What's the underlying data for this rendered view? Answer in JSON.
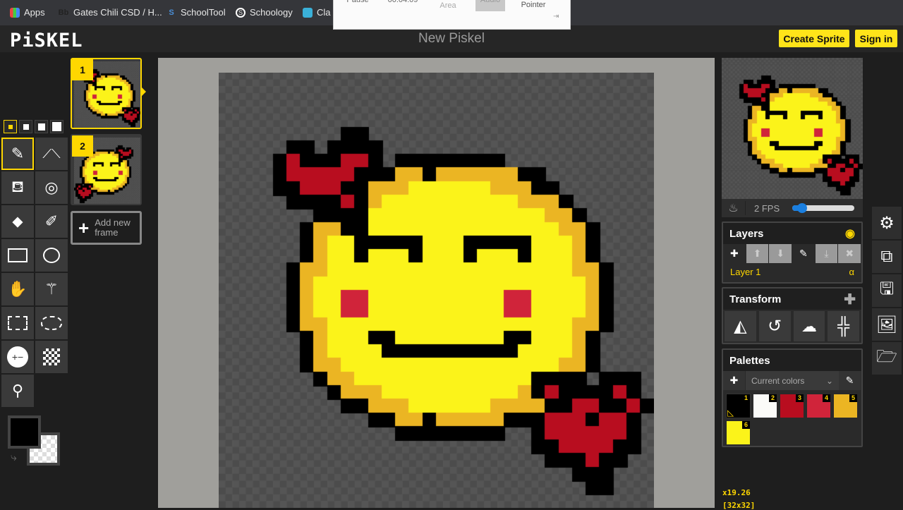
{
  "bookmarks": [
    {
      "icon": "apps-grid-icon",
      "label": "Apps"
    },
    {
      "icon": "blackboard-icon",
      "label": "Gates Chili CSD / H..."
    },
    {
      "icon": "schooltool-icon",
      "label": "SchoolTool"
    },
    {
      "icon": "schoology-icon",
      "label": "Schoology"
    },
    {
      "icon": "classroom-icon",
      "label": "Cla"
    }
  ],
  "snip_toolbar": {
    "items": [
      "Pause",
      "00:04:09",
      "Area",
      "Audio",
      "Pointer"
    ]
  },
  "header": {
    "logo": "PiSKEL",
    "title": "New Piskel",
    "create_sprite": "Create Sprite",
    "sign_in": "Sign in"
  },
  "frames": [
    {
      "number": "1",
      "selected": true
    },
    {
      "number": "2",
      "selected": false
    }
  ],
  "add_frame": "Add new frame",
  "tools": [
    "pen",
    "vertical-mirror-pen",
    "paint-bucket",
    "paint-same-color",
    "eraser",
    "stroke",
    "rectangle",
    "circle",
    "move",
    "shape-select",
    "rectangle-select",
    "lasso-select",
    "lighten",
    "dithering",
    "color-picker"
  ],
  "colors": {
    "primary": "#000000",
    "secondary": "transparent",
    "accent": "#ffd700"
  },
  "preview": {
    "fps": "2 FPS",
    "fps_value": 2,
    "fps_fraction": 0.08
  },
  "layers": {
    "title": "Layers",
    "items": [
      {
        "name": "Layer 1",
        "opacity_label": "α"
      }
    ]
  },
  "transform": {
    "title": "Transform",
    "tools": [
      "flip-icon",
      "rotate-icon",
      "clone-sheep-icon",
      "center-icon"
    ]
  },
  "palettes": {
    "title": "Palettes",
    "selected": "Current colors",
    "swatches": [
      {
        "n": "1",
        "color": "#000000"
      },
      {
        "n": "2",
        "color": "#fbfbf8"
      },
      {
        "n": "3",
        "color": "#b80d1f"
      },
      {
        "n": "4",
        "color": "#d0243a"
      },
      {
        "n": "5",
        "color": "#ebb523"
      },
      {
        "n": "6",
        "color": "#fbf31a"
      }
    ]
  },
  "status": {
    "zoom": "x19.26",
    "size": "[32x32]"
  },
  "sprite": {
    "palette": {
      "k": "#000000",
      "r": "#b80d1f",
      "p": "#d0243a",
      "o": "#ebb523",
      "y": "#fbf31a",
      "w": "#fbfbf8"
    },
    "pixels": [
      "................................",
      "................................",
      "................................",
      "................................",
      ".........kk.....................",
      ".....kk.kkkk....................",
      "....krkkkrrk.kkkkkkkk...........",
      "....krrrrrkkkookooooookk.........",
      "....kkrrrkkoooyyyyyyoookk.......",
      ".....kkkkrkoyyyyyyyyyyoook......",
      ".......kkkkyyyyyyyyyyyyyook.....",
      "......kookkyyyyyyyyyyyyyyook....",
      "......koyykkkkkyyykkkkkyyyok....",
      "......koyykyyykyyykyyykyyyok....",
      ".....kooyyyyyyyyyyyyyyyyyyook...",
      ".....koyyyyyyyyyyyyyyyyyyyyok...",
      ".....koyyppyyyyyyyyyyppyyyyok...",
      ".....koyyppyyyyyyyyyyppyyyyok...",
      ".....kooyyyyyyyyyyyyyyyyyyook...",
      "......koyyykkyyyyyyyykkyyyok....",
      "......koyyyykkkkkkkkkkyyyyok....",
      "......kooyyyyyyyyyyyyyyyyook....",
      ".......kooyyyyyyyyyyyyykkkk.kkk.",
      "........koooyyyyyyyyyyokrkkkkrk.",
      ".........kkoooyyyyyyooookkrrkkrk.",
      "...........kkookoooookkkrrrkrrk.",
      ".............kkkkkkkk..krrrrrrk.",
      ".......................kkrrrrkk.",
      "........................kkkrkk..",
      "..........................kkk...",
      "...........................kk...",
      "................................"
    ]
  }
}
